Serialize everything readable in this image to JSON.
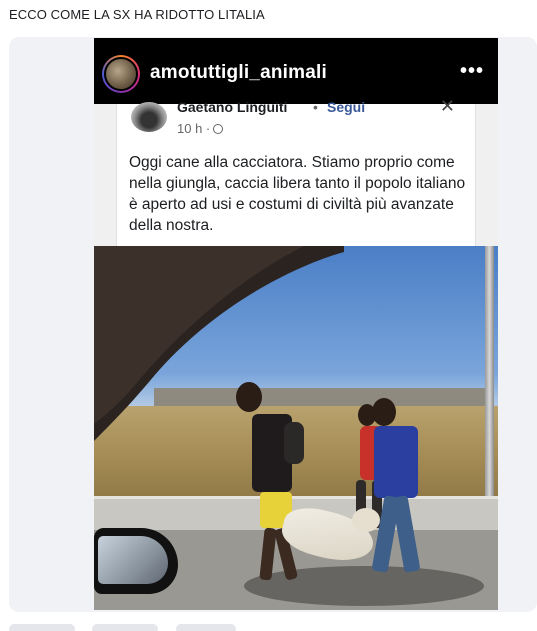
{
  "post": {
    "caption": "ECCO COME LA SX HA RIDOTTO LITALIA"
  },
  "instagram": {
    "username": "amotuttigli_animali",
    "more_icon": "more-horizontal-icon",
    "more_label": "•••"
  },
  "facebook_post": {
    "author": "Gaetano Linguiti",
    "separator": "•",
    "follow_label": "Segui",
    "close_label": "✕",
    "time": "10 h ·",
    "audience_icon": "globe-icon",
    "text": "Oggi cane alla cacciatora. Stiamo proprio come nella giungla, caccia libera tanto il popolo italiano è aperto ad usi e costumi di civiltà più avanzate della nostra."
  },
  "colors": {
    "link": "#385898",
    "card_bg": "#f0f2f5",
    "ig_bg": "#000000"
  }
}
